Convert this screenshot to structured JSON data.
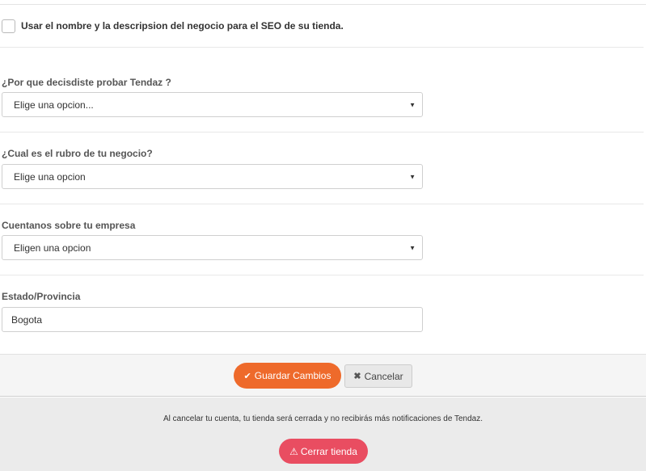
{
  "seo": {
    "checked": false,
    "label": "Usar el nombre y la descripsion del negocio para el SEO de su tienda."
  },
  "fields": {
    "reason": {
      "label": "¿Por que decisdiste probar Tendaz ?",
      "selected": "Elige una opcion..."
    },
    "industry": {
      "label": "¿Cual es el rubro de tu negocio?",
      "selected": "Elige una opcion"
    },
    "company": {
      "label": "Cuentanos sobre tu empresa",
      "selected": "Eligen una opcion"
    },
    "state": {
      "label": "Estado/Provincia",
      "value": "Bogota"
    }
  },
  "actions": {
    "save_label": "Guardar Cambios",
    "save_icon": "check-icon",
    "cancel_label": "Cancelar",
    "cancel_icon": "x-icon"
  },
  "danger": {
    "notice": "Al cancelar tu cuenta, tu tienda será cerrada y no recibirás más notificaciones de Tendaz.",
    "close_label": "Cerrar tienda",
    "close_icon": "warning-icon"
  },
  "colors": {
    "save_button": "#ee6a2b",
    "close_button": "#e94d61",
    "cancel_button": "#e8e8e8"
  }
}
